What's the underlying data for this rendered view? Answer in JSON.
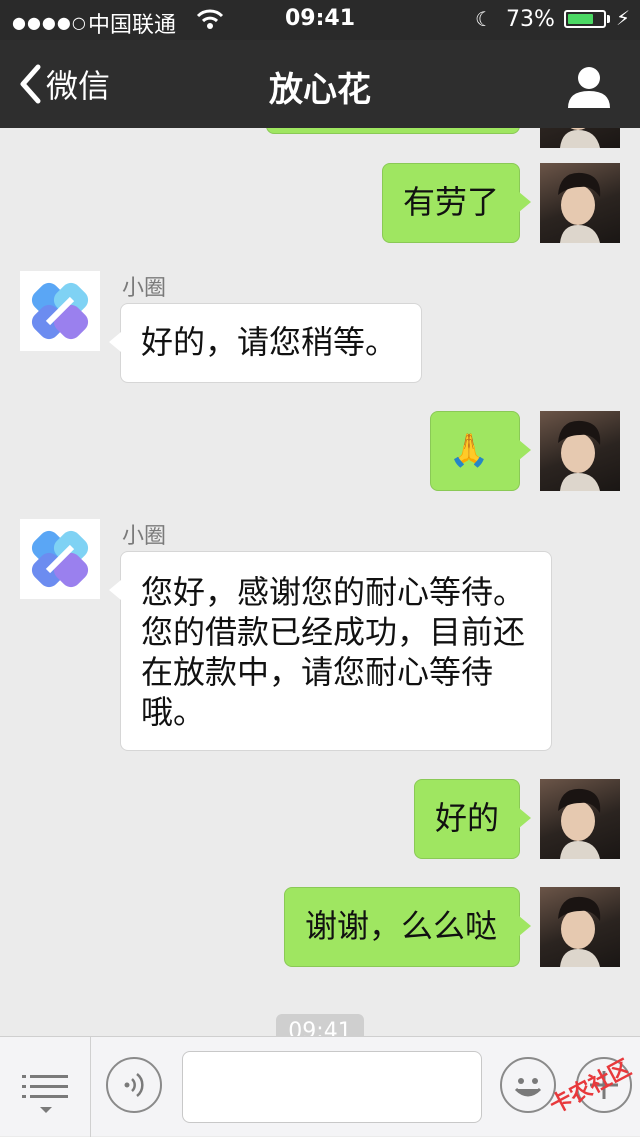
{
  "status_bar": {
    "signal": "●●●●○",
    "carrier": "中国联通",
    "time": "09:41",
    "battery": "73%",
    "battery_level": 0.73
  },
  "nav": {
    "back_label": "微信",
    "title": "放心花"
  },
  "messages": [
    {
      "side": "out",
      "text": "有劳了"
    },
    {
      "side": "in",
      "sender": "小圈",
      "text": "好的，请您稍等。"
    },
    {
      "side": "out",
      "text": "🙏"
    },
    {
      "side": "in",
      "sender": "小圈",
      "lines": [
        "您好，感谢您的耐心等待。",
        "您的借款已经成功，目前还",
        "在放款中，请您耐心等待",
        "哦。"
      ]
    },
    {
      "side": "out",
      "text": "好的"
    },
    {
      "side": "out",
      "text": "谢谢，么么哒"
    }
  ],
  "timestamp": "09:41",
  "watermark": "卡农社区",
  "colors": {
    "nav_bg": "#2e2e2e",
    "chat_bg": "#ebebeb",
    "bubble_out": "#9fe661",
    "bubble_in": "#ffffff",
    "battery_green": "#4cd964",
    "logo_blue": "#5aa6f5"
  },
  "icons": [
    "wifi-icon",
    "moon-icon",
    "battery-icon",
    "charging-icon",
    "back-chevron-icon",
    "profile-icon",
    "menu-list-icon",
    "voice-icon",
    "emoji-icon",
    "plus-icon",
    "bot-logo-icon"
  ]
}
